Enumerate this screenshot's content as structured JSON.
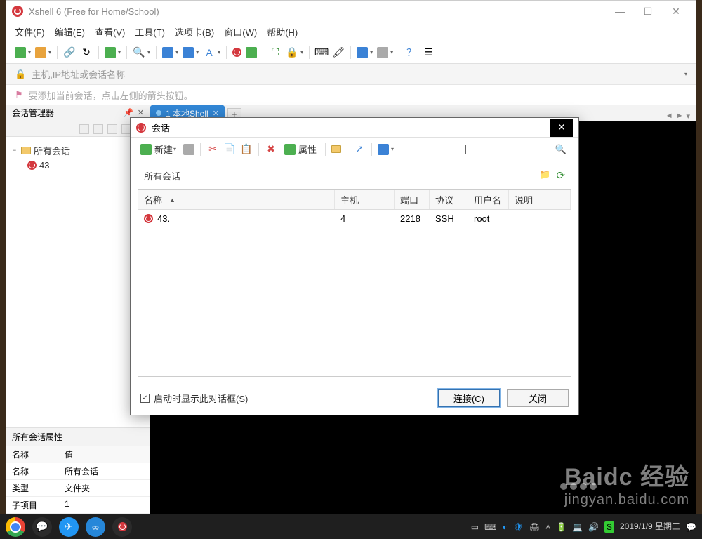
{
  "title": "Xshell 6 (Free for Home/School)",
  "menu": {
    "file": "文件(F)",
    "edit": "编辑(E)",
    "view": "查看(V)",
    "tools": "工具(T)",
    "tabs": "选项卡(B)",
    "window": "窗口(W)",
    "help": "帮助(H)"
  },
  "address": {
    "placeholder": "主机,IP地址或会话名称"
  },
  "hint": "要添加当前会话，点击左侧的箭头按钮。",
  "sidebar": {
    "title": "会话管理器",
    "root": "所有会话",
    "item0": "43"
  },
  "tab": {
    "label": "1 本地Shell"
  },
  "props": {
    "title": "所有会话属性",
    "col_name": "名称",
    "col_value": "值",
    "row1k": "名称",
    "row1v": "所有会话",
    "row2k": "类型",
    "row2v": "文件夹",
    "row3k": "子项目",
    "row3v": "1"
  },
  "dialog": {
    "title": "会话",
    "new_btn": "新建",
    "prop_btn": "属性",
    "path": "所有会话",
    "cols": {
      "name": "名称",
      "host": "主机",
      "port": "端口",
      "proto": "协议",
      "user": "用户名",
      "desc": "说明"
    },
    "row": {
      "name": "43.",
      "host": "4",
      "port": "2218",
      "proto": "SSH",
      "user": "root",
      "desc": ""
    },
    "startup_chk": "启动时显示此对话框(S)",
    "connect": "连接(C)",
    "close": "关闭"
  },
  "taskbar": {
    "date": "2019/1/9 星期三"
  },
  "watermark": {
    "brand": "Baidc 经验",
    "url": "jingyan.baidu.com"
  }
}
